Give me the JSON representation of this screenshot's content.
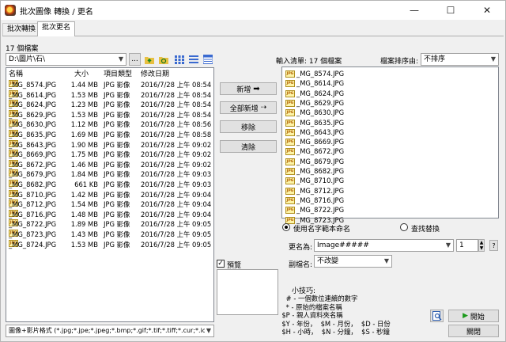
{
  "window": {
    "title": "批次圖像 轉換 / 更名",
    "min": "—",
    "max": "☐",
    "close": "✕"
  },
  "tabs": [
    "批次轉換",
    "批次更名"
  ],
  "left": {
    "count": "17 個檔案",
    "path": "D:\\圖片\\石\\",
    "browse": "...",
    "headers": {
      "name": "名稱",
      "size": "大小",
      "type": "項目類型",
      "date": "修改日期"
    },
    "files": [
      {
        "name": "_MG_8574.JPG",
        "size": "1.44 MB",
        "type": "JPG 影像",
        "date": "2016/7/28 上午 08:54"
      },
      {
        "name": "_MG_8614.JPG",
        "size": "1.53 MB",
        "type": "JPG 影像",
        "date": "2016/7/28 上午 08:54"
      },
      {
        "name": "_MG_8624.JPG",
        "size": "1.23 MB",
        "type": "JPG 影像",
        "date": "2016/7/28 上午 08:54"
      },
      {
        "name": "_MG_8629.JPG",
        "size": "1.53 MB",
        "type": "JPG 影像",
        "date": "2016/7/28 上午 08:54"
      },
      {
        "name": "_MG_8630.JPG",
        "size": "1.12 MB",
        "type": "JPG 影像",
        "date": "2016/7/28 上午 08:56"
      },
      {
        "name": "_MG_8635.JPG",
        "size": "1.69 MB",
        "type": "JPG 影像",
        "date": "2016/7/28 上午 08:58"
      },
      {
        "name": "_MG_8643.JPG",
        "size": "1.90 MB",
        "type": "JPG 影像",
        "date": "2016/7/28 上午 09:02"
      },
      {
        "name": "_MG_8669.JPG",
        "size": "1.75 MB",
        "type": "JPG 影像",
        "date": "2016/7/28 上午 09:02"
      },
      {
        "name": "_MG_8672.JPG",
        "size": "1.46 MB",
        "type": "JPG 影像",
        "date": "2016/7/28 上午 09:02"
      },
      {
        "name": "_MG_8679.JPG",
        "size": "1.84 MB",
        "type": "JPG 影像",
        "date": "2016/7/28 上午 09:03"
      },
      {
        "name": "_MG_8682.JPG",
        "size": "661 KB",
        "type": "JPG 影像",
        "date": "2016/7/28 上午 09:03"
      },
      {
        "name": "_MG_8710.JPG",
        "size": "1.42 MB",
        "type": "JPG 影像",
        "date": "2016/7/28 上午 09:04"
      },
      {
        "name": "_MG_8712.JPG",
        "size": "1.54 MB",
        "type": "JPG 影像",
        "date": "2016/7/28 上午 09:04"
      },
      {
        "name": "_MG_8716.JPG",
        "size": "1.48 MB",
        "type": "JPG 影像",
        "date": "2016/7/28 上午 09:04"
      },
      {
        "name": "_MG_8722.JPG",
        "size": "1.89 MB",
        "type": "JPG 影像",
        "date": "2016/7/28 上午 09:05"
      },
      {
        "name": "_MG_8723.JPG",
        "size": "1.43 MB",
        "type": "JPG 影像",
        "date": "2016/7/28 上午 09:05"
      },
      {
        "name": "_MG_8724.JPG",
        "size": "1.53 MB",
        "type": "JPG 影像",
        "date": "2016/7/28 上午 09:05"
      }
    ],
    "filter": "圖像+影片格式 (*.jpg;*.jpe;*.jpeg;*.bmp;*.gif;*.tif;*.tiff;*.cur;*.ic"
  },
  "mid": {
    "add": "新增",
    "add_all": "全部新增",
    "remove": "移除",
    "clear": "清除",
    "preview": "預覽"
  },
  "right": {
    "input_label": "輸入清單: 17 個檔案",
    "sort_label": "檔案排序由:",
    "sort_value": "不排序",
    "list": [
      "_MG_8574.JPG",
      "_MG_8614.JPG",
      "_MG_8624.JPG",
      "_MG_8629.JPG",
      "_MG_8630.JPG",
      "_MG_8635.JPG",
      "_MG_8643.JPG",
      "_MG_8669.JPG",
      "_MG_8672.JPG",
      "_MG_8679.JPG",
      "_MG_8682.JPG",
      "_MG_8710.JPG",
      "_MG_8712.JPG",
      "_MG_8716.JPG",
      "_MG_8722.JPG",
      "_MG_8723.JPG"
    ],
    "radio_template": "使用名字範本命名",
    "radio_replace": "查找替換",
    "rename_label": "更名為:",
    "rename_value": "Image#####",
    "start_value": "1",
    "help": "?",
    "ext_label": "副檔名:",
    "ext_value": "不改變",
    "tips_title": "小技巧:",
    "tips": "    # - 一個數位連續的數字\n    * - 原始的檔案名稱\n  $P - 親人資料夾名稱\n  $Y - 年份，  $M - 月份，  $D - 日份\n  $H - 小時，  $N - 分鐘，  $S - 秒鐘",
    "start": "開始",
    "close": "關閉"
  }
}
